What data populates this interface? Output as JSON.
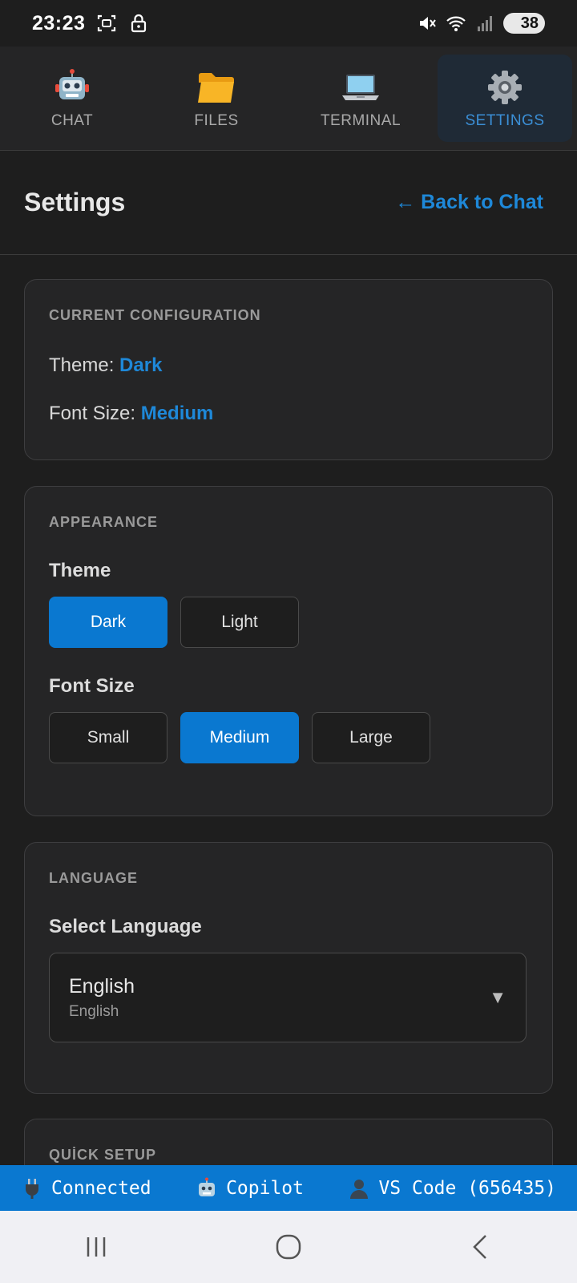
{
  "status_bar": {
    "time": "23:23",
    "battery": "38"
  },
  "tabs": [
    {
      "label": "CHAT",
      "icon": "robot-icon",
      "active": false
    },
    {
      "label": "FILES",
      "icon": "folder-icon",
      "active": false
    },
    {
      "label": "TERMINAL",
      "icon": "laptop-icon",
      "active": false
    },
    {
      "label": "SETTINGS",
      "icon": "gear-icon",
      "active": true
    }
  ],
  "header": {
    "title": "Settings",
    "back_label": "← Back to Chat"
  },
  "current_config": {
    "title": "CURRENT CONFIGURATION",
    "theme_label": "Theme:",
    "theme_value": "Dark",
    "font_label": "Font Size:",
    "font_value": "Medium"
  },
  "appearance": {
    "title": "APPEARANCE",
    "theme_label": "Theme",
    "theme_options": [
      "Dark",
      "Light"
    ],
    "theme_selected": "Dark",
    "font_label": "Font Size",
    "font_options": [
      "Small",
      "Medium",
      "Large"
    ],
    "font_selected": "Medium"
  },
  "language": {
    "title": "LANGUAGE",
    "select_label": "Select Language",
    "selected_name": "English",
    "selected_native": "English",
    "arrow": "▼"
  },
  "quick_setup": {
    "title": "QUİCK SETUP"
  },
  "app_status": {
    "connection": "Connected",
    "agent": "Copilot",
    "client": "VS Code (656435)"
  },
  "colors": {
    "accent": "#0a78d0",
    "link": "#1e88d8",
    "background": "#1e1e1e",
    "card": "#252526"
  }
}
